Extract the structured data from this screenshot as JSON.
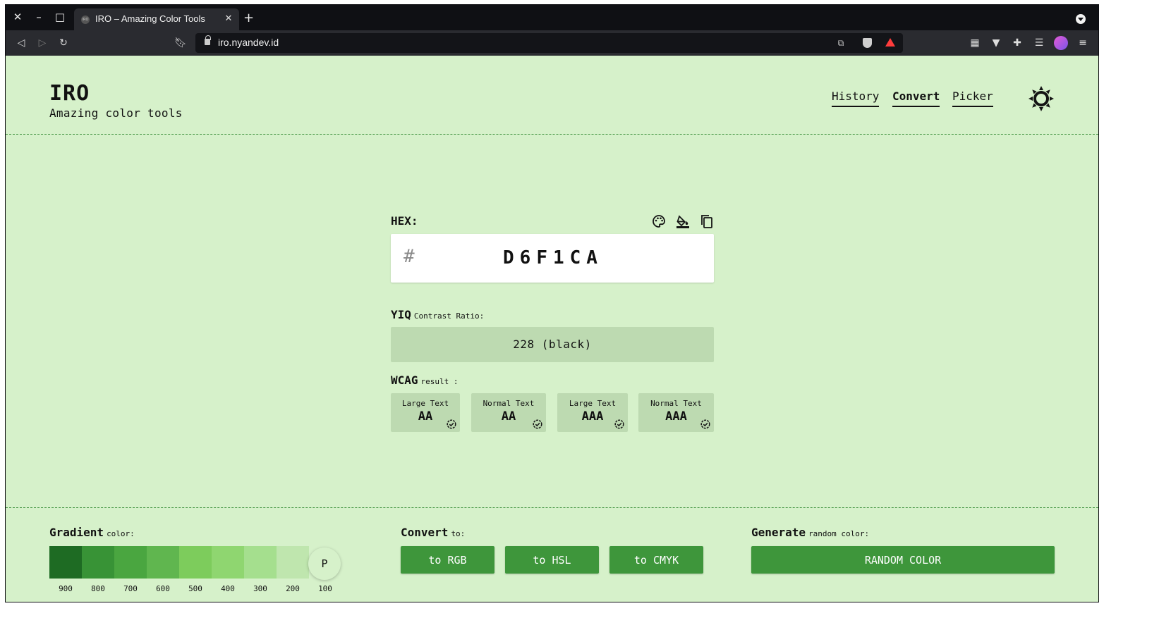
{
  "browser": {
    "tab_favicon": "IRO",
    "tab_title": "IRO – Amazing Color Tools",
    "url": "iro.nyandev.id"
  },
  "header": {
    "logo": "IRO",
    "tagline": "Amazing color tools",
    "nav": [
      "History",
      "Convert",
      "Picker"
    ]
  },
  "hex": {
    "label": "HEX:",
    "prefix": "#",
    "value": "D6F1CA"
  },
  "yiq": {
    "title": "YIQ",
    "subtitle": "Contrast Ratio:",
    "value": "228 (black)"
  },
  "wcag": {
    "title": "WCAG",
    "subtitle": "result :",
    "items": [
      {
        "size": "Large Text",
        "level": "AA"
      },
      {
        "size": "Normal Text",
        "level": "AA"
      },
      {
        "size": "Large Text",
        "level": "AAA"
      },
      {
        "size": "Normal Text",
        "level": "AAA"
      }
    ]
  },
  "gradient": {
    "title": "Gradient",
    "subtitle": "color:",
    "labels": [
      "900",
      "800",
      "700",
      "600",
      "500",
      "400",
      "300",
      "200",
      "100"
    ],
    "swatch_colors": [
      "#1e6b23",
      "#389336",
      "#4aa640",
      "#60b64f",
      "#7dcc5c",
      "#8fd670",
      "#a5df8e",
      "#bfe6ae"
    ],
    "picker_label": "P"
  },
  "convert": {
    "title": "Convert",
    "subtitle": "to:",
    "buttons": [
      "to RGB",
      "to HSL",
      "to CMYK"
    ]
  },
  "generate": {
    "title": "Generate",
    "subtitle": "random color:",
    "button": "RANDOM COLOR"
  },
  "colors": {
    "background": "#d6f1ca",
    "accent": "#3e963b",
    "panel": "#bddab1"
  }
}
